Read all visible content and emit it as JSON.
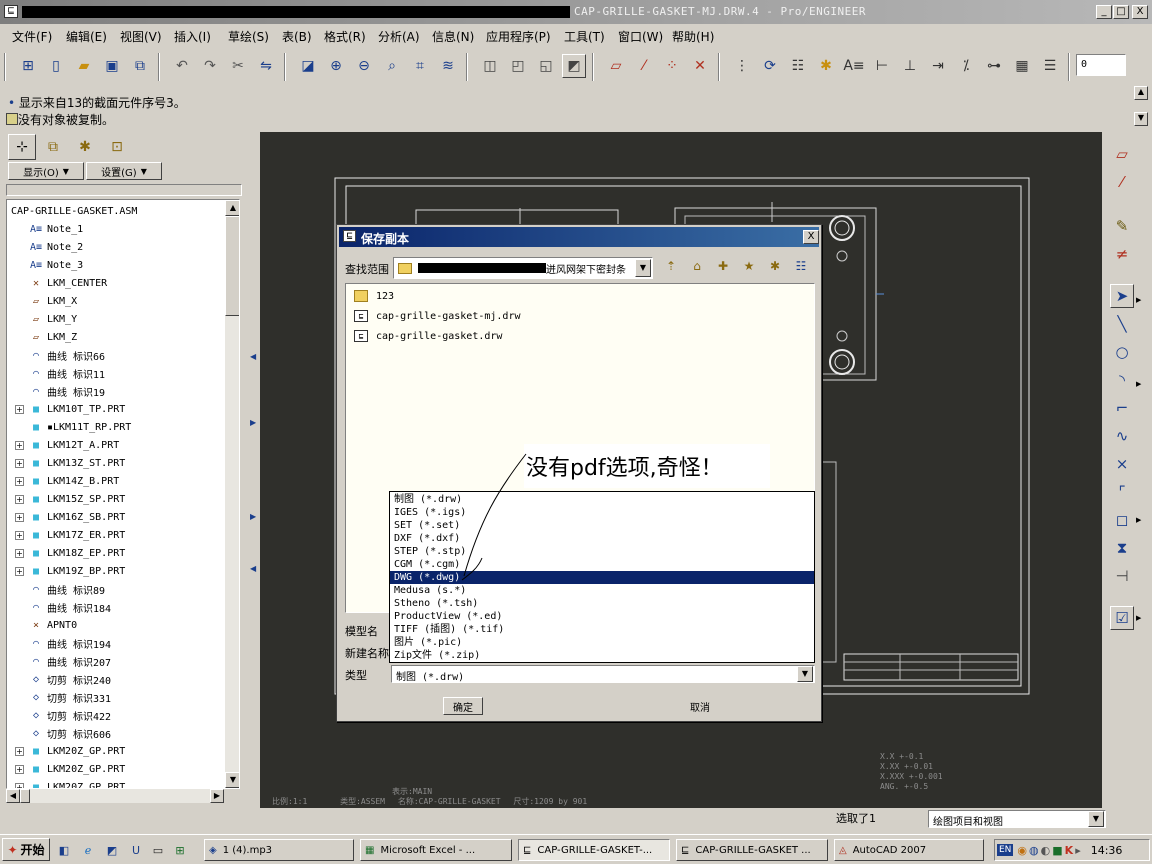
{
  "window": {
    "title": "CAP-GRILLE-GASKET-MJ.DRW.4 - Pro/ENGINEER",
    "min_label": "_",
    "max_label": "□",
    "close_label": "X"
  },
  "menu": [
    {
      "label": "文件(F)"
    },
    {
      "label": "编辑(E)"
    },
    {
      "label": "视图(V)"
    },
    {
      "label": "插入(I)"
    },
    {
      "label": "草绘(S)"
    },
    {
      "label": "表(B)"
    },
    {
      "label": "格式(R)"
    },
    {
      "label": "分析(A)"
    },
    {
      "label": "信息(N)"
    },
    {
      "label": "应用程序(P)"
    },
    {
      "label": "工具(T)"
    },
    {
      "label": "窗口(W)"
    },
    {
      "label": "帮助(H)"
    }
  ],
  "toolbar": {
    "spin_value": "0"
  },
  "messages": [
    {
      "bullet": "•",
      "text": "显示来自13的截面元件序号3。"
    },
    {
      "bullet": "",
      "text": "没有对象被复制。"
    }
  ],
  "tree": {
    "show_label": "显示(O)",
    "settings_label": "设置(G)",
    "root": "CAP-GRILLE-GASKET.ASM",
    "items": [
      {
        "label": "Note_1",
        "icon": "note-icon",
        "glyph": "A≡",
        "expand": false
      },
      {
        "label": "Note_2",
        "icon": "note-icon",
        "glyph": "A≡",
        "expand": false
      },
      {
        "label": "Note_3",
        "icon": "note-icon",
        "glyph": "A≡",
        "expand": false
      },
      {
        "label": "LKM_CENTER",
        "icon": "csys-icon",
        "glyph": "✕",
        "expand": false
      },
      {
        "label": "LKM_X",
        "icon": "datum-plane-icon",
        "glyph": "▱",
        "expand": false
      },
      {
        "label": "LKM_Y",
        "icon": "datum-plane-icon",
        "glyph": "▱",
        "expand": false
      },
      {
        "label": "LKM_Z",
        "icon": "datum-plane-icon",
        "glyph": "▱",
        "expand": false
      },
      {
        "label": "曲线 标识66",
        "icon": "curve-icon",
        "glyph": "⌒",
        "expand": false
      },
      {
        "label": "曲线 标识11",
        "icon": "curve-icon",
        "glyph": "⌒",
        "expand": false
      },
      {
        "label": "曲线 标识19",
        "icon": "curve-icon",
        "glyph": "⌒",
        "expand": false
      },
      {
        "label": "LKM10T_TP.PRT",
        "icon": "part-icon",
        "glyph": "■",
        "expand": true
      },
      {
        "label": "▪LKM11T_RP.PRT",
        "icon": "part-icon",
        "glyph": "■",
        "expand": false
      },
      {
        "label": "LKM12T_A.PRT",
        "icon": "part-icon",
        "glyph": "■",
        "expand": true
      },
      {
        "label": "LKM13Z_ST.PRT",
        "icon": "part-icon",
        "glyph": "■",
        "expand": true
      },
      {
        "label": "LKM14Z_B.PRT",
        "icon": "part-icon",
        "glyph": "■",
        "expand": true
      },
      {
        "label": "LKM15Z_SP.PRT",
        "icon": "part-icon",
        "glyph": "■",
        "expand": true
      },
      {
        "label": "LKM16Z_SB.PRT",
        "icon": "part-icon",
        "glyph": "■",
        "expand": true
      },
      {
        "label": "LKM17Z_ER.PRT",
        "icon": "part-icon",
        "glyph": "■",
        "expand": true
      },
      {
        "label": "LKM18Z_EP.PRT",
        "icon": "part-icon",
        "glyph": "■",
        "expand": true
      },
      {
        "label": "LKM19Z_BP.PRT",
        "icon": "part-icon",
        "glyph": "■",
        "expand": true
      },
      {
        "label": "曲线 标识89",
        "icon": "curve-icon",
        "glyph": "⌒",
        "expand": false
      },
      {
        "label": "曲线 标识184",
        "icon": "curve-icon",
        "glyph": "⌒",
        "expand": false
      },
      {
        "label": "APNT0",
        "icon": "point-icon",
        "glyph": "×",
        "expand": false
      },
      {
        "label": "曲线 标识194",
        "icon": "curve-icon",
        "glyph": "⌒",
        "expand": false
      },
      {
        "label": "曲线 标识207",
        "icon": "curve-icon",
        "glyph": "⌒",
        "expand": false
      },
      {
        "label": "切剪 标识240",
        "icon": "cut-icon",
        "glyph": "◇",
        "expand": false
      },
      {
        "label": "切剪 标识331",
        "icon": "cut-icon",
        "glyph": "◇",
        "expand": false
      },
      {
        "label": "切剪 标识422",
        "icon": "cut-icon",
        "glyph": "◇",
        "expand": false
      },
      {
        "label": "切剪 标识606",
        "icon": "cut-icon",
        "glyph": "◇",
        "expand": false
      },
      {
        "label": "LKM20Z_GP.PRT",
        "icon": "part-icon",
        "glyph": "■",
        "expand": true
      },
      {
        "label": "LKM20Z_GP.PRT",
        "icon": "part-icon",
        "glyph": "■",
        "expand": true
      },
      {
        "label": "LKM20Z_GP.PRT",
        "icon": "part-icon",
        "glyph": "■",
        "expand": true
      }
    ]
  },
  "dialog": {
    "title": "保存副本",
    "close_label": "X",
    "lookin_label": "查找范围",
    "lookin_value": "迸风网架下密封条",
    "files": [
      {
        "name": "123",
        "icon": "folder-icon"
      },
      {
        "name": "cap-grille-gasket-mj.drw",
        "icon": "drawing-file-icon"
      },
      {
        "name": "cap-grille-gasket.drw",
        "icon": "drawing-file-icon"
      }
    ],
    "model_name_label": "模型名",
    "new_name_label": "新建名称",
    "type_label": "类型",
    "type_value": "制图 (*.drw)",
    "type_options": [
      "制图 (*.drw)",
      "IGES (*.igs)",
      "SET (*.set)",
      "DXF (*.dxf)",
      "STEP (*.stp)",
      "CGM (*.cgm)",
      "DWG (*.dwg)",
      "Medusa (s.*)",
      "Stheno (*.tsh)",
      "ProductView (*.ed)",
      "TIFF (插图) (*.tif)",
      "图片 (*.pic)",
      "Zip文件 (*.zip)"
    ],
    "selected_option_index": 6,
    "ok_label": "确定",
    "cancel_label": "取消",
    "annotation": "没有pdf选项,奇怪！"
  },
  "graphics": {
    "tolerance_lines": [
      "X.X  +-0.1",
      "X.XX  +-0.01",
      "X.XXX +-0.001",
      "ANG.  +-0.5"
    ],
    "sheet_info": {
      "scale": "比例:1:1",
      "type": "类型:ASSEM",
      "name": "名称:CAP-GRILLE-GASKET",
      "size": "尺寸:1209 by 901",
      "sheet": "表示:MAIN"
    }
  },
  "status": {
    "selected": "选取了1",
    "filter_value": "绘图项目和视图"
  },
  "taskbar": {
    "start_label": "开始",
    "tasks": [
      {
        "label": "1 (4).mp3"
      },
      {
        "label": "Microsoft Excel - ..."
      },
      {
        "label": "CAP-GRILLE-GASKET-..."
      },
      {
        "label": "CAP-GRILLE-GASKET ..."
      },
      {
        "label": "AutoCAD 2007"
      }
    ],
    "lang": "EN",
    "clock": "14:36"
  }
}
